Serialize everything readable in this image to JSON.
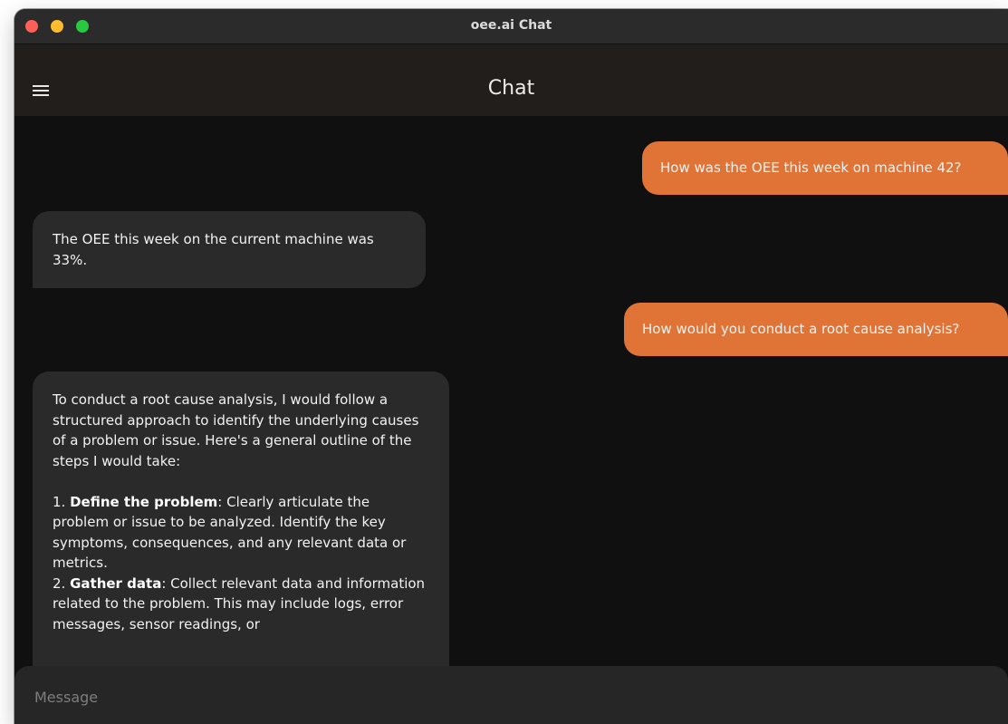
{
  "window": {
    "title": "oee.ai Chat"
  },
  "appbar": {
    "title": "Chat",
    "menu_icon": "hamburger-menu-icon"
  },
  "colors": {
    "user_bubble": "#e07436",
    "bot_bubble": "#2a2a2a",
    "background": "#101010",
    "appbar": "#221e1b"
  },
  "messages": [
    {
      "role": "user",
      "text": "How was the OEE this week on machine 42?"
    },
    {
      "role": "bot",
      "text": "The OEE this week on the current machine was 33%."
    },
    {
      "role": "user",
      "text": "How would you conduct a root cause analysis?"
    },
    {
      "role": "bot",
      "intro": "To conduct a root cause analysis, I would follow a structured approach to identify the underlying causes of a problem or issue. Here's a general outline of the steps I would take:",
      "steps": [
        {
          "num": "1.",
          "title": "Define the problem",
          "body": ": Clearly articulate the problem or issue to be analyzed. Identify the key symptoms, consequences, and any relevant data or metrics."
        },
        {
          "num": "2.",
          "title": "Gather data",
          "body": ": Collect relevant data and information related to the problem. This may include logs, error messages, sensor readings, or"
        }
      ]
    }
  ],
  "composer": {
    "placeholder": "Message",
    "value": ""
  }
}
